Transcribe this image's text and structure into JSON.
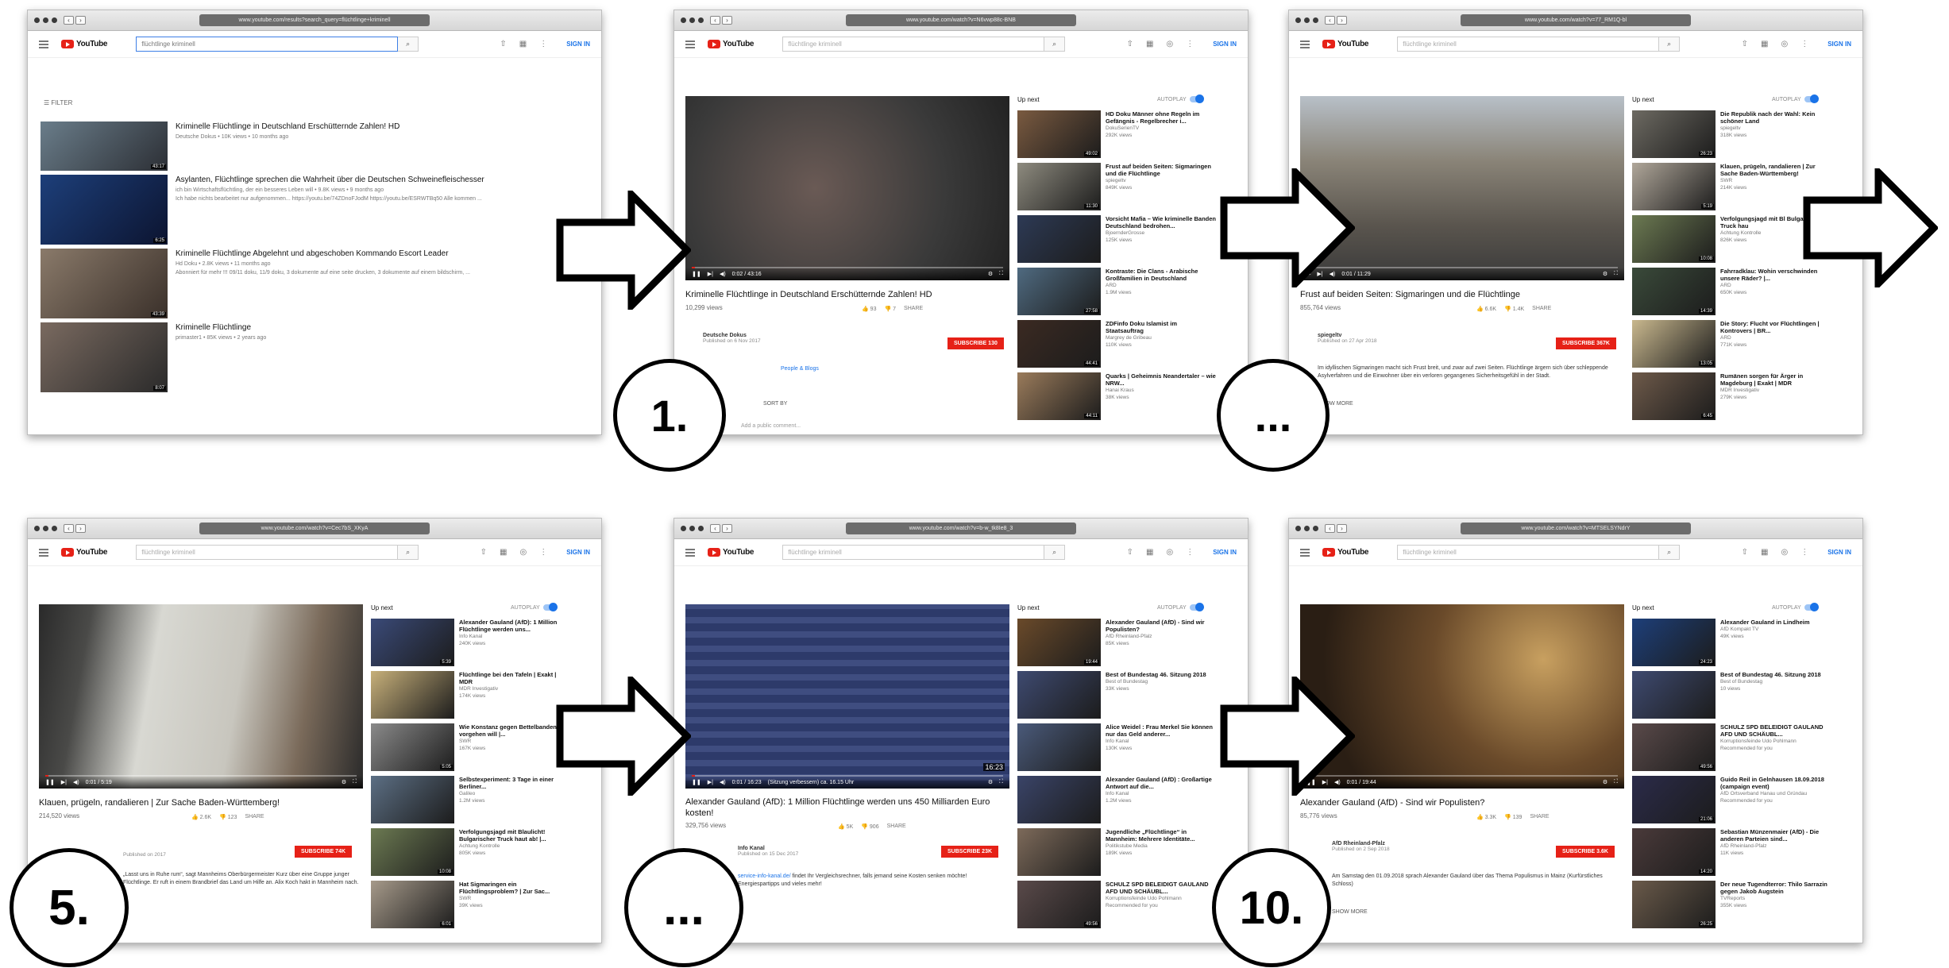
{
  "search_query": "flüchtlinge kriminell",
  "signin": "SIGN IN",
  "autoplay": "AUTOPLAY",
  "upnext": "Up next",
  "filter": "FILTER",
  "share": "SHARE",
  "sortby": "SORT BY",
  "logo": "YouTube",
  "panels": {
    "p0": {
      "url": "www.youtube.com/results?search_query=flüchtlinge+kriminell",
      "results": [
        {
          "title": "Kriminelle Flüchtlinge in Deutschland Erschütternde Zahlen! HD",
          "meta": "Deutsche Dokus • 10K views • 10 months ago",
          "desc": "",
          "dur": "43:17"
        },
        {
          "title": "Asylanten, Flüchtlinge sprechen die Wahrheit über die Deutschen Schweinefleischesser",
          "meta": "ich bin Wirtschaftsflüchtling, der ein besseres Leben will • 9.8K views • 9 months ago",
          "desc": "Ich habe nichts bearbeitet nur aufgenommen... https://youtu.be/74ZDnoFJodM https://youtu.be/ESRWTBq50 Alle kommen ...",
          "dur": "6:25"
        },
        {
          "title": "Kriminelle Flüchtlinge Abgelehnt und abgeschoben Kommando Escort Leader",
          "meta": "Hd Doku • 2.8K views • 11 months ago",
          "desc": "Abonniert für mehr !!! 09/11 doku, 11/9 doku, 3 dokumente auf eine seite drucken, 3 dokumente auf einem bildschirm, ...",
          "dur": "43:39"
        },
        {
          "title": "Kriminelle Flüchtlinge",
          "meta": "primaster1 • 85K views • 2 years ago",
          "desc": "",
          "dur": "8:07"
        }
      ]
    },
    "p1": {
      "url": "www.youtube.com/watch?v=N6vwp88c-BNB",
      "time": "0:02 / 43:16",
      "title": "Kriminelle Flüchtlinge in Deutschland Erschütternde Zahlen! HD",
      "views": "10,299 views",
      "likes": "93",
      "dislikes": "7",
      "channel": "Deutsche Dokus",
      "published": "Published on 6 Nov 2017",
      "subscribe": "SUBSCRIBE 130",
      "category": "People & Blogs",
      "comment": "Add a public comment...",
      "recs": [
        {
          "t": "HD Doku Männer ohne Regeln im Gefängnis - Regelbrecher i...",
          "c": "DokuSerienTV",
          "v": "292K views",
          "d": "49:02",
          "col": "#7a5a40"
        },
        {
          "t": "Frust auf beiden Seiten: Sigmaringen und die Flüchtlinge",
          "c": "spiegeltv",
          "v": "849K views",
          "d": "11:30",
          "col": "#8e8b7f"
        },
        {
          "t": "Vorsicht Mafia – Wie kriminelle Banden Deutschland bedrohen...",
          "c": "BjoernderGrosse",
          "v": "125K views",
          "d": "",
          "col": "#2d3a55"
        },
        {
          "t": "Kontraste: Die Clans - Arabische Großfamilien in Deutschland",
          "c": "ARD",
          "v": "1.9M views",
          "d": "27:58",
          "col": "#4f6a80"
        },
        {
          "t": "ZDFinfo Doku Islamist im Staatsauftrag",
          "c": "Margrey de Gribeau",
          "v": "110K views",
          "d": "44:41",
          "col": "#3b2a22"
        },
        {
          "t": "Quarks | Geheimnis Neandertaler – wie NRW...",
          "c": "Hanai Kraus",
          "v": "38K views",
          "d": "44:11",
          "col": "#9a7b5b"
        }
      ]
    },
    "p2": {
      "url": "www.youtube.com/watch?v=77_RM1Q-bl",
      "time": "0:01 / 11:29",
      "title": "Frust auf beiden Seiten: Sigmaringen und die Flüchtlinge",
      "views": "855,764 views",
      "likes": "6.6K",
      "dislikes": "1.4K",
      "channel": "spiegeltv",
      "published": "Published on 27 Apr 2018",
      "subscribe": "SUBSCRIBE 367K",
      "desc": "Im idyllischen Sigmaringen macht sich Frust breit, und zwar auf zwei Seiten. Flüchtlinge ärgern sich über schleppende Asylverfahren und die Einwohner über ein verloren gegangenes Sicherheitsgefühl in der Stadt.",
      "more": "SHOW MORE",
      "recs": [
        {
          "t": "Die Republik nach der Wahl: Kein schöner Land",
          "c": "spiegeltv",
          "v": "318K views",
          "d": "26:23",
          "col": "#6d6a62"
        },
        {
          "t": "Klauen, prügeln, randalieren | Zur Sache Baden-Württemberg!",
          "c": "SWR",
          "v": "214K views",
          "d": "5:19",
          "col": "#b0a79a"
        },
        {
          "t": "Verfolgungsjagd mit Bl Bulgarischer Truck hau",
          "c": "Achtung Kontrolle",
          "v": "826K views",
          "d": "10:08",
          "col": "#6c7a52"
        },
        {
          "t": "Fahrradklau: Wohin verschwinden unsere Räder? |...",
          "c": "ARD",
          "v": "650K views",
          "d": "14:39",
          "col": "#3a4a3a"
        },
        {
          "t": "Die Story: Flucht vor Flüchtlingen | Kontrovers | BR...",
          "c": "ARD",
          "v": "771K views",
          "d": "13:05",
          "col": "#c9b88e"
        },
        {
          "t": "Rumänen sorgen für Ärger in Magdeburg | Exakt | MDR",
          "c": "MDR Investigativ",
          "v": "279K views",
          "d": "6:45",
          "col": "#6e5a4a"
        }
      ]
    },
    "p3": {
      "url": "www.youtube.com/watch?v=Cec7bS_XKyA",
      "time": "0:01 / 5:19",
      "title": "Klauen, prügeln, randalieren | Zur Sache Baden-Württemberg!",
      "views": "214,520 views",
      "likes": "2.6K",
      "dislikes": "123",
      "published": "Published on 2017",
      "subscribe": "SUBSCRIBE 74K",
      "desc": "„Lasst uns in Ruhe rum“, sagt Mannheims Oberbürgermeister Kurz über eine Gruppe junger Flüchtlinge. Er ruft in einem Brandbrief das Land um Hilfe an. Alix Koch hakt in Mannheim nach.",
      "recs": [
        {
          "t": "Alexander Gauland (AfD): 1 Million Flüchtlinge werden uns...",
          "c": "Info Kanal",
          "v": "240K views",
          "d": "5:39",
          "col": "#3a4a78"
        },
        {
          "t": "Flüchtlinge bei den Tafeln | Exakt | MDR",
          "c": "MDR Investigativ",
          "v": "174K views",
          "d": "",
          "col": "#c7b07a"
        },
        {
          "t": "Wie Konstanz gegen Bettelbanden vorgehen will |...",
          "c": "SWR",
          "v": "167K views",
          "d": "5:05",
          "col": "#8a8a8a"
        },
        {
          "t": "Selbstexperiment: 3 Tage in einer Berliner...",
          "c": "Galileo",
          "v": "1.2M views",
          "d": "",
          "col": "#5c6f84"
        },
        {
          "t": "Verfolgungsjagd mit Blaulicht! Bulgarischer Truck haut ab! |...",
          "c": "Achtung Kontrolle",
          "v": "805K views",
          "d": "10:08",
          "col": "#6c7a52"
        },
        {
          "t": "Hat Sigmaringen ein Flüchtlingsproblem? | Zur Sac...",
          "c": "SWR",
          "v": "39K views",
          "d": "6:01",
          "col": "#a69a8a"
        }
      ]
    },
    "p4": {
      "url": "www.youtube.com/watch?v=b-w_tk8Ie8_3",
      "time": "0:01 / 16:23",
      "caption": "(Sitzung verbessern) ca. 16.15 Uhr",
      "title": "Alexander Gauland (AfD): 1 Million Flüchtlinge werden uns 450 Milliarden Euro kosten!",
      "views": "329,756 views",
      "likes": "5K",
      "dislikes": "906",
      "channel": "Info Kanal",
      "published": "Published on 15 Dec 2017",
      "subscribe": "SUBSCRIBE 23K",
      "link": "service-info-kanal.de/",
      "desc": "findet Ihr Vergleichsrechner, falls jemand seine Kosten senken möchte! Energiespartipps und vieles mehr!",
      "badge": "16:23",
      "recs": [
        {
          "t": "Alexander Gauland (AfD) - Sind wir Populisten?",
          "c": "AfD Rheinland-Pfalz",
          "v": "85K views",
          "d": "19:44",
          "col": "#6a4a2a"
        },
        {
          "t": "Best of Bundestag 46. Sitzung 2018",
          "c": "Best of Bundestag",
          "v": "33K views",
          "d": "",
          "col": "#3e4a70"
        },
        {
          "t": "Alice Weidel : Frau Merkel Sie können nur das Geld anderer...",
          "c": "Info Kanal",
          "v": "130K views",
          "d": "",
          "col": "#4a5a7a"
        },
        {
          "t": "Alexander Gauland (AfD) : Großartige Antwort auf die...",
          "c": "Info Kanal",
          "v": "1.2M views",
          "d": "",
          "col": "#3a4468"
        },
        {
          "t": "Jugendliche „Flüchtlinge“ in Mannheim: Mehrere Identitäte...",
          "c": "Politikstube Media",
          "v": "189K views",
          "d": "",
          "col": "#7d6a5a"
        },
        {
          "t": "SCHULZ SPD BELEIDIGT GAULAND AFD UND SCHÄUBL...",
          "c": "Korruptionsfeinde Udo Pohlmann",
          "v": "Recommended for you",
          "d": "49:56",
          "col": "#5a4a4a"
        }
      ]
    },
    "p5": {
      "url": "www.youtube.com/watch?v=MTSELSYNdrY",
      "time": "0:01 / 19:44",
      "title": "Alexander Gauland (AfD) - Sind wir Populisten?",
      "views": "85,776 views",
      "likes": "3.3K",
      "dislikes": "139",
      "channel": "AfD Rheinland-Pfalz",
      "published": "Published on 2 Sep 2018",
      "subscribe": "SUBSCRIBE 3.6K",
      "desc": "Am Samstag den 01.09.2018 sprach Alexander Gauland über das Thema Populismus in Mainz (Kurfürstliches Schloss)",
      "more": "SHOW MORE",
      "recs": [
        {
          "t": "Alexander Gauland in Lindheim",
          "c": "AfD Kompakt TV",
          "v": "49K views",
          "d": "24:23",
          "col": "#1d3f7a"
        },
        {
          "t": "Best of Bundestag 46. Sitzung 2018",
          "c": "Best of Bundestag",
          "v": "10 views",
          "d": "",
          "col": "#3e4a70"
        },
        {
          "t": "SCHULZ SPD BELEIDIGT GAULAND AFD UND SCHÄUBL...",
          "c": "Korruptionsfeinde Udo Pohlmann",
          "v": "Recommended for you",
          "d": "49:56",
          "col": "#5a4a4a"
        },
        {
          "t": "Guido Reil in Gelnhausen 18.09.2018 (campaign event)",
          "c": "AfD Ortsverband Hanau und Gründau",
          "v": "Recommended for you",
          "d": "21:06",
          "col": "#2b2b4a"
        },
        {
          "t": "Sebastian Münzenmaier (AfD) - Die anderen Parteien sind...",
          "c": "AfD Rheinland-Pfalz",
          "v": "11K views",
          "d": "14:20",
          "col": "#4a3a3a"
        },
        {
          "t": "Der neue Tugendterror: Thilo Sarrazin gegen Jakob Augstein",
          "c": "TVReports",
          "v": "355K views",
          "d": "26:25",
          "col": "#6a5a4a"
        }
      ]
    }
  },
  "labels": {
    "step1": "1.",
    "step5": "5.",
    "step10": "10.",
    "ellipsis1": "...",
    "ellipsis2": "..."
  },
  "colors": {
    "red": "#e62117",
    "blue": "#1a73e8"
  }
}
